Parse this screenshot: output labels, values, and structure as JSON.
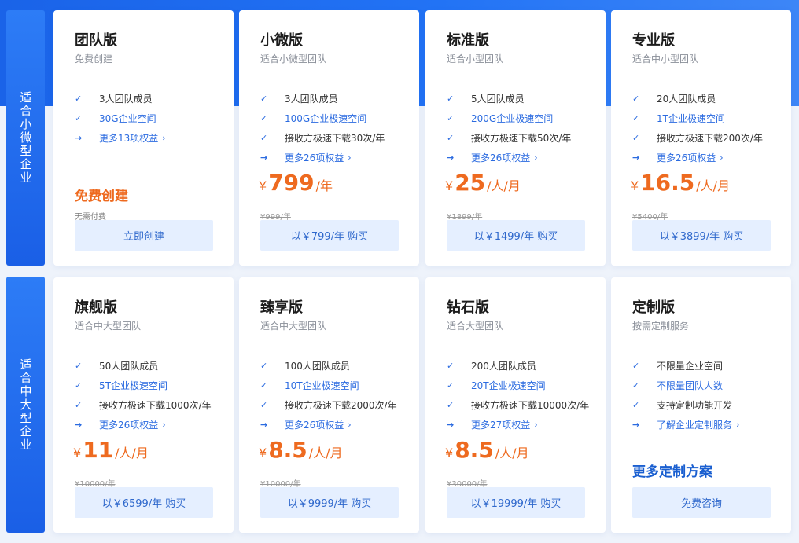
{
  "bands": [
    {
      "label": "适合小微型企业"
    },
    {
      "label": "适合中大型企业"
    }
  ],
  "plans": [
    {
      "title": "团队版",
      "subtitle": "免费创建",
      "features": [
        {
          "text": "3人团队成员",
          "style": "check"
        },
        {
          "text": "30G企业空间",
          "style": "check-blue"
        },
        {
          "text": "更多13项权益",
          "style": "link"
        }
      ],
      "free_title": "免费创建",
      "free_sub": "无需付费",
      "button": "立即创建"
    },
    {
      "title": "小微版",
      "subtitle": "适合小微型团队",
      "features": [
        {
          "text": "3人团队成员",
          "style": "check"
        },
        {
          "text": "100G企业极速空间",
          "style": "check-blue"
        },
        {
          "text": "接收方极速下载30次/年",
          "style": "check"
        },
        {
          "text": "更多26项权益",
          "style": "link"
        }
      ],
      "price": {
        "currency": "¥",
        "amount": "799",
        "unit": "/年",
        "original": "¥999/年"
      },
      "button": "以￥799/年 购买"
    },
    {
      "title": "标准版",
      "subtitle": "适合小型团队",
      "features": [
        {
          "text": "5人团队成员",
          "style": "check"
        },
        {
          "text": "200G企业极速空间",
          "style": "check-blue"
        },
        {
          "text": "接收方极速下载50次/年",
          "style": "check"
        },
        {
          "text": "更多26项权益",
          "style": "link"
        }
      ],
      "price": {
        "currency": "¥",
        "amount": "25",
        "unit": "/人/月",
        "original": "¥1899/年"
      },
      "button": "以￥1499/年 购买"
    },
    {
      "title": "专业版",
      "subtitle": "适合中小型团队",
      "features": [
        {
          "text": "20人团队成员",
          "style": "check"
        },
        {
          "text": "1T企业极速空间",
          "style": "check-blue"
        },
        {
          "text": "接收方极速下载200次/年",
          "style": "check"
        },
        {
          "text": "更多26项权益",
          "style": "link"
        }
      ],
      "price": {
        "currency": "¥",
        "amount": "16.5",
        "unit": "/人/月",
        "original": "¥5400/年"
      },
      "button": "以￥3899/年 购买"
    },
    {
      "title": "旗舰版",
      "subtitle": "适合中大型团队",
      "features": [
        {
          "text": "50人团队成员",
          "style": "check"
        },
        {
          "text": "5T企业极速空间",
          "style": "check-blue"
        },
        {
          "text": "接收方极速下载1000次/年",
          "style": "check"
        },
        {
          "text": "更多26项权益",
          "style": "link"
        }
      ],
      "price": {
        "currency": "¥",
        "amount": "11",
        "unit": "/人/月",
        "original": "¥10000/年"
      },
      "button": "以￥6599/年 购买"
    },
    {
      "title": "臻享版",
      "subtitle": "适合中大型团队",
      "features": [
        {
          "text": "100人团队成员",
          "style": "check"
        },
        {
          "text": "10T企业极速空间",
          "style": "check-blue"
        },
        {
          "text": "接收方极速下载2000次/年",
          "style": "check"
        },
        {
          "text": "更多26项权益",
          "style": "link"
        }
      ],
      "price": {
        "currency": "¥",
        "amount": "8.5",
        "unit": "/人/月",
        "original": "¥10000/年"
      },
      "button": "以￥9999/年 购买"
    },
    {
      "title": "钻石版",
      "subtitle": "适合大型团队",
      "features": [
        {
          "text": "200人团队成员",
          "style": "check"
        },
        {
          "text": "20T企业极速空间",
          "style": "check-blue"
        },
        {
          "text": "接收方极速下载10000次/年",
          "style": "check"
        },
        {
          "text": "更多27项权益",
          "style": "link"
        }
      ],
      "price": {
        "currency": "¥",
        "amount": "8.5",
        "unit": "/人/月",
        "original": "¥30000/年"
      },
      "button": "以￥19999/年 购买"
    },
    {
      "title": "定制版",
      "subtitle": "按需定制服务",
      "features": [
        {
          "text": "不限量企业空间",
          "style": "check"
        },
        {
          "text": "不限量团队人数",
          "style": "check-blue"
        },
        {
          "text": "支持定制功能开发",
          "style": "check"
        },
        {
          "text": "了解企业定制服务",
          "style": "link"
        }
      ],
      "custom_title": "更多定制方案",
      "button": "免费咨询"
    }
  ],
  "icons": {
    "check": "check-icon",
    "arrow": "arrow-right-icon",
    "chevron": "chevron-right-icon"
  },
  "colors": {
    "accent": "#2b6be0",
    "price": "#ee6a1f",
    "button_bg": "#e5efff",
    "band": "#1a5fe6"
  }
}
